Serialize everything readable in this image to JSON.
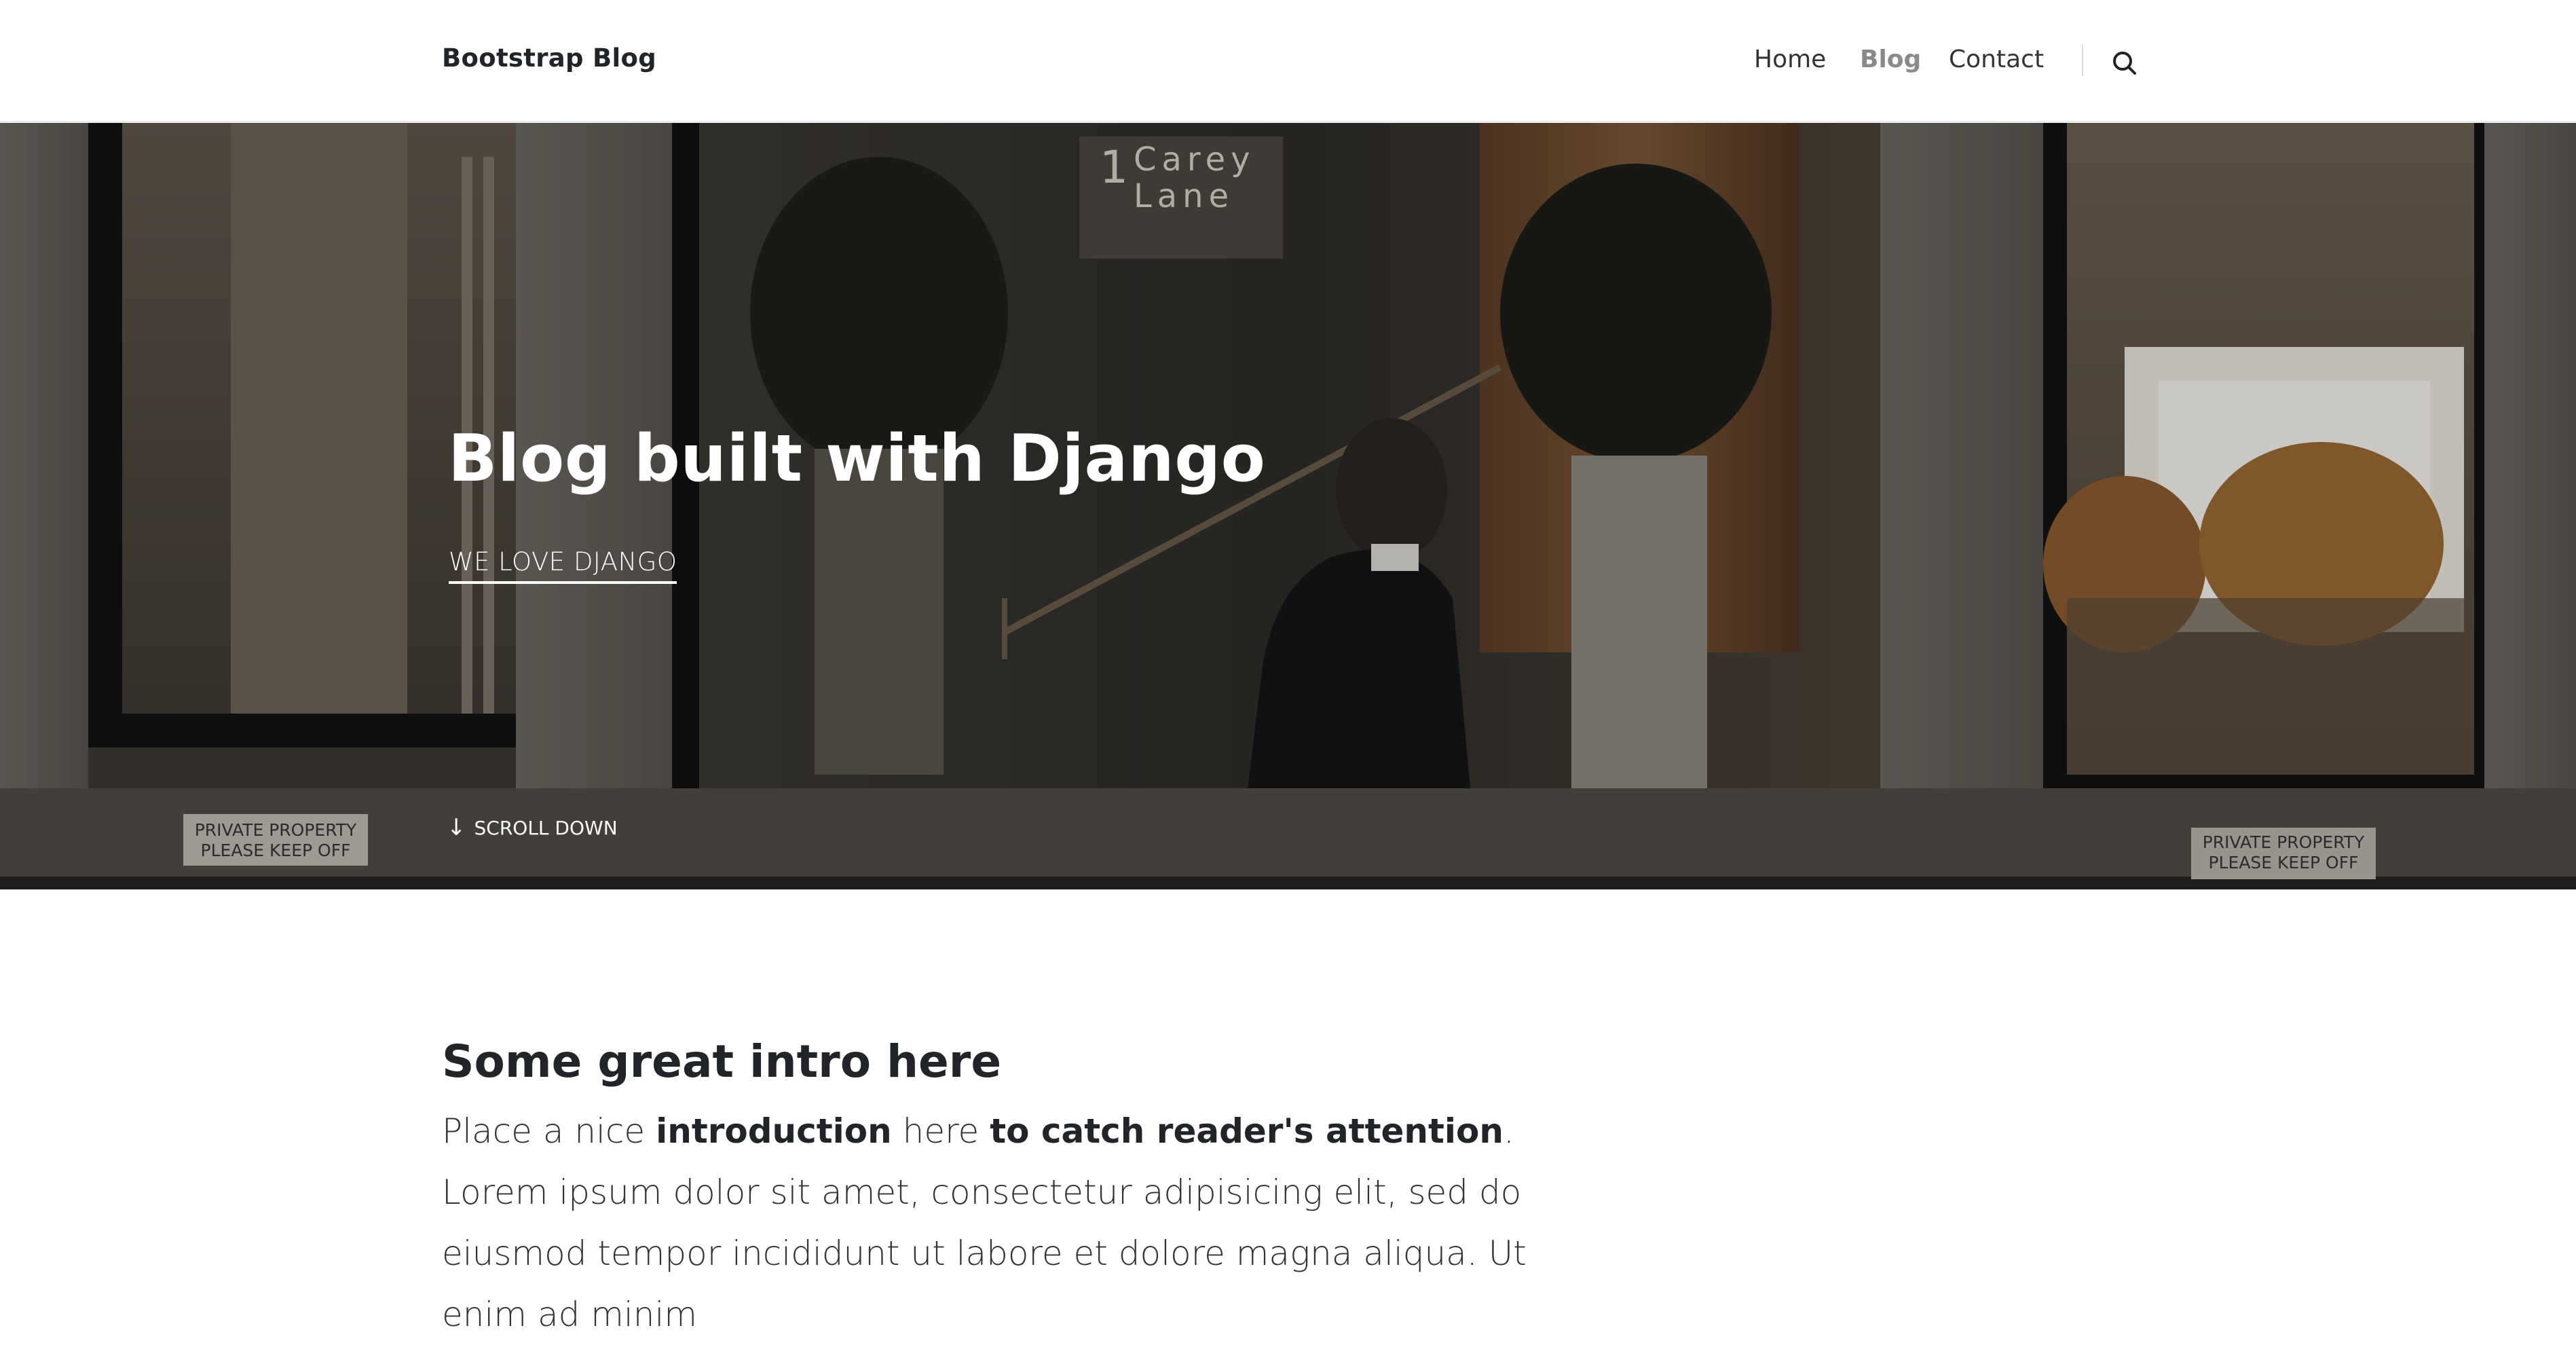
{
  "navbar": {
    "brand": "Bootstrap Blog",
    "items": [
      {
        "label": "Home"
      },
      {
        "label": "Blog"
      },
      {
        "label": "Contact"
      }
    ],
    "search_icon": "search-icon",
    "active_color": "#8a8a8a"
  },
  "hero": {
    "title": "Blog built with Django",
    "subtitle": "WE LOVE DJANGO",
    "scroll_label": "SCROLL DOWN",
    "scroll_icon": "arrow-down-icon"
  },
  "intro": {
    "heading": "Some great intro here",
    "text_part1": "Place a nice ",
    "text_bold1": "introduction",
    "text_part2": " here ",
    "text_bold2": "to catch reader's attention",
    "text_part3": ". Lorem ipsum dolor sit amet, consectetur adipisicing elit, sed do eiusmod tempor incididunt ut labore et dolore magna aliqua. Ut enim ad minim"
  }
}
